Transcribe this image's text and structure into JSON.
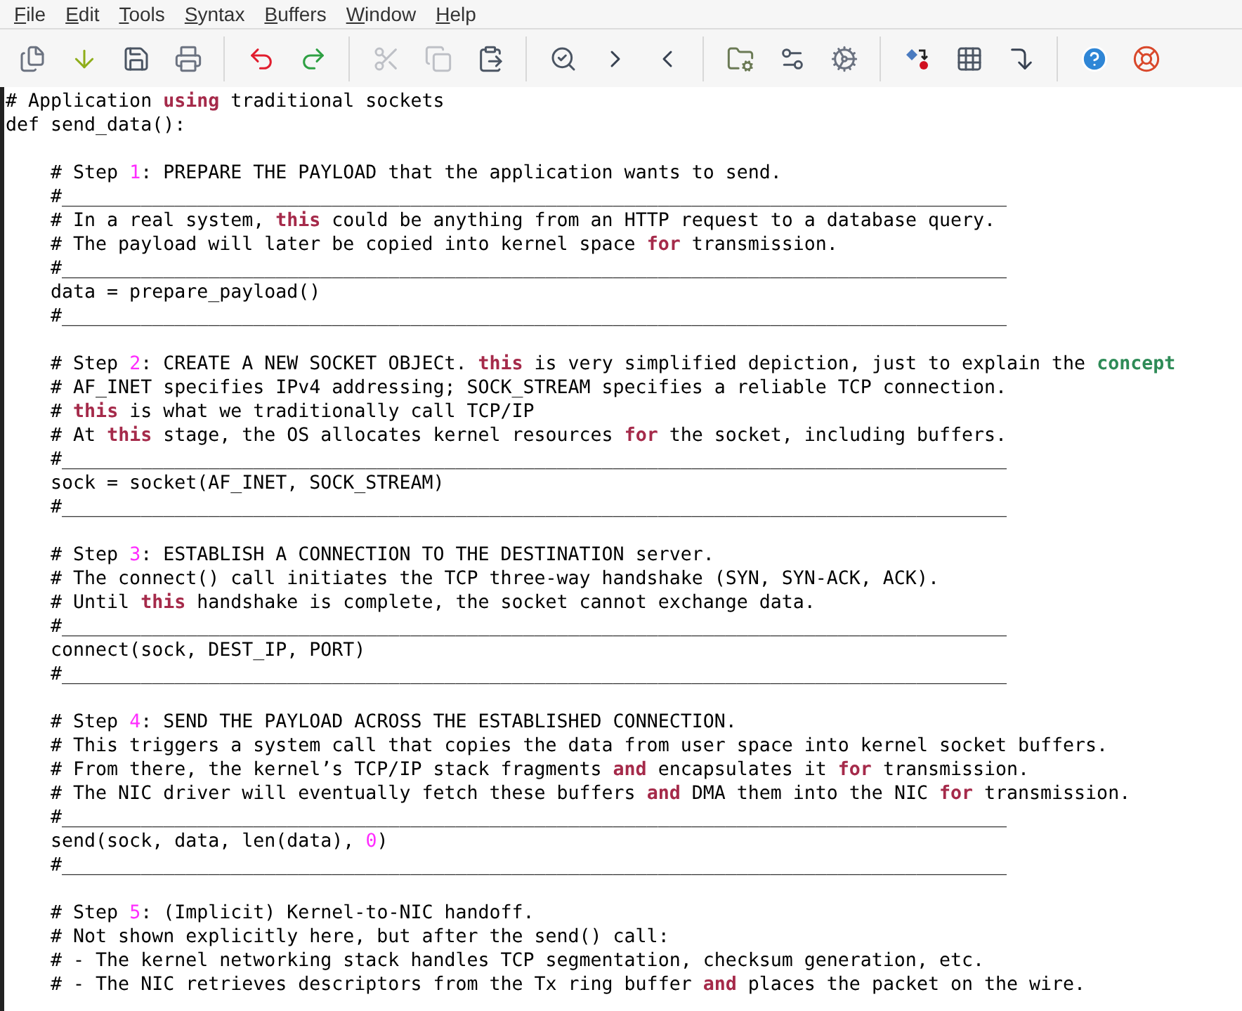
{
  "menu": [
    {
      "label": "File"
    },
    {
      "label": "Edit"
    },
    {
      "label": "Tools"
    },
    {
      "label": "Syntax"
    },
    {
      "label": "Buffers"
    },
    {
      "label": "Window"
    },
    {
      "label": "Help"
    }
  ],
  "toolbar_groups": [
    {
      "buttons": [
        {
          "kind": "open",
          "disabled": false
        },
        {
          "kind": "load",
          "disabled": false
        },
        {
          "kind": "save",
          "disabled": false
        },
        {
          "kind": "print",
          "disabled": false
        }
      ]
    },
    {
      "buttons": [
        {
          "kind": "undo",
          "disabled": false
        },
        {
          "kind": "redo",
          "disabled": false
        }
      ]
    },
    {
      "buttons": [
        {
          "kind": "cut",
          "disabled": true
        },
        {
          "kind": "copy",
          "disabled": true
        },
        {
          "kind": "paste",
          "disabled": false
        }
      ]
    },
    {
      "buttons": [
        {
          "kind": "find",
          "disabled": false
        },
        {
          "kind": "next",
          "disabled": false
        },
        {
          "kind": "prev",
          "disabled": false
        }
      ]
    },
    {
      "buttons": [
        {
          "kind": "load_session",
          "disabled": false
        },
        {
          "kind": "save_session",
          "disabled": false
        },
        {
          "kind": "run_script",
          "disabled": false
        }
      ]
    },
    {
      "buttons": [
        {
          "kind": "make",
          "disabled": false
        },
        {
          "kind": "tags",
          "disabled": false
        },
        {
          "kind": "jump",
          "disabled": false
        }
      ]
    },
    {
      "buttons": [
        {
          "kind": "help",
          "disabled": false
        },
        {
          "kind": "find_help",
          "disabled": false
        }
      ]
    }
  ],
  "editor_lines": [
    {
      "kind": "code",
      "segments": [
        {
          "text": "# Application ",
          "kind": "plain"
        },
        {
          "text": "using",
          "kind": "keyword"
        },
        {
          "text": " traditional sockets",
          "kind": "plain"
        }
      ]
    },
    {
      "kind": "code",
      "segments": [
        {
          "text": "def send_data():",
          "kind": "plain"
        }
      ]
    },
    {
      "kind": "blank"
    },
    {
      "kind": "code",
      "segments": [
        {
          "text": "    # Step ",
          "kind": "plain"
        },
        {
          "text": "1",
          "kind": "number"
        },
        {
          "text": ": PREPARE THE PAYLOAD that the application wants to send.",
          "kind": "plain"
        }
      ]
    },
    {
      "kind": "code",
      "segments": [
        {
          "text": "    #____________________________________________________________________________________",
          "kind": "plain"
        }
      ]
    },
    {
      "kind": "code",
      "segments": [
        {
          "text": "    # In a real system, ",
          "kind": "plain"
        },
        {
          "text": "this",
          "kind": "keyword"
        },
        {
          "text": " could be anything from an HTTP request to a database query.",
          "kind": "plain"
        }
      ]
    },
    {
      "kind": "code",
      "segments": [
        {
          "text": "    # The payload will later be copied into kernel space ",
          "kind": "plain"
        },
        {
          "text": "for",
          "kind": "keyword"
        },
        {
          "text": " transmission.",
          "kind": "plain"
        }
      ]
    },
    {
      "kind": "code",
      "segments": [
        {
          "text": "    #____________________________________________________________________________________",
          "kind": "plain"
        }
      ]
    },
    {
      "kind": "code",
      "segments": [
        {
          "text": "    data = prepare_payload()",
          "kind": "plain"
        }
      ]
    },
    {
      "kind": "code",
      "segments": [
        {
          "text": "    #____________________________________________________________________________________",
          "kind": "plain"
        }
      ]
    },
    {
      "kind": "blank"
    },
    {
      "kind": "code",
      "segments": [
        {
          "text": "    # Step ",
          "kind": "plain"
        },
        {
          "text": "2",
          "kind": "number"
        },
        {
          "text": ": CREATE A NEW SOCKET OBJECt. ",
          "kind": "plain"
        },
        {
          "text": "this",
          "kind": "keyword"
        },
        {
          "text": " is very simplified depiction, just to explain the ",
          "kind": "plain"
        },
        {
          "text": "concept",
          "kind": "special"
        }
      ]
    },
    {
      "kind": "code",
      "segments": [
        {
          "text": "    # AF_INET specifies IPv4 addressing; SOCK_STREAM specifies a reliable TCP connection.",
          "kind": "plain"
        }
      ]
    },
    {
      "kind": "code",
      "segments": [
        {
          "text": "    # ",
          "kind": "plain"
        },
        {
          "text": "this",
          "kind": "keyword"
        },
        {
          "text": " is what we traditionally call TCP/IP",
          "kind": "plain"
        }
      ]
    },
    {
      "kind": "code",
      "segments": [
        {
          "text": "    # At ",
          "kind": "plain"
        },
        {
          "text": "this",
          "kind": "keyword"
        },
        {
          "text": " stage, the OS allocates kernel resources ",
          "kind": "plain"
        },
        {
          "text": "for",
          "kind": "keyword"
        },
        {
          "text": " the socket, including buffers.",
          "kind": "plain"
        }
      ]
    },
    {
      "kind": "code",
      "segments": [
        {
          "text": "    #____________________________________________________________________________________",
          "kind": "plain"
        }
      ]
    },
    {
      "kind": "code",
      "segments": [
        {
          "text": "    sock = socket(AF_INET, SOCK_STREAM)",
          "kind": "plain"
        }
      ]
    },
    {
      "kind": "code",
      "segments": [
        {
          "text": "    #____________________________________________________________________________________",
          "kind": "plain"
        }
      ]
    },
    {
      "kind": "blank"
    },
    {
      "kind": "code",
      "segments": [
        {
          "text": "    # Step ",
          "kind": "plain"
        },
        {
          "text": "3",
          "kind": "number"
        },
        {
          "text": ": ESTABLISH A CONNECTION TO THE DESTINATION server.",
          "kind": "plain"
        }
      ]
    },
    {
      "kind": "code",
      "segments": [
        {
          "text": "    # The connect() call initiates the TCP three-way handshake (SYN, SYN-ACK, ACK).",
          "kind": "plain"
        }
      ]
    },
    {
      "kind": "code",
      "segments": [
        {
          "text": "    # Until ",
          "kind": "plain"
        },
        {
          "text": "this",
          "kind": "keyword"
        },
        {
          "text": " handshake is complete, the socket cannot exchange data.",
          "kind": "plain"
        }
      ]
    },
    {
      "kind": "code",
      "segments": [
        {
          "text": "    #____________________________________________________________________________________",
          "kind": "plain"
        }
      ]
    },
    {
      "kind": "code",
      "segments": [
        {
          "text": "    connect(sock, DEST_IP, PORT)",
          "kind": "plain"
        }
      ]
    },
    {
      "kind": "code",
      "segments": [
        {
          "text": "    #____________________________________________________________________________________",
          "kind": "plain"
        }
      ]
    },
    {
      "kind": "blank"
    },
    {
      "kind": "code",
      "segments": [
        {
          "text": "    # Step ",
          "kind": "plain"
        },
        {
          "text": "4",
          "kind": "number"
        },
        {
          "text": ": SEND THE PAYLOAD ACROSS THE ESTABLISHED CONNECTION.",
          "kind": "plain"
        }
      ]
    },
    {
      "kind": "code",
      "segments": [
        {
          "text": "    # This triggers a system call that copies the data from user space into kernel socket buffers.",
          "kind": "plain"
        }
      ]
    },
    {
      "kind": "code",
      "segments": [
        {
          "text": "    # From there, the kernel’s TCP/IP stack fragments ",
          "kind": "plain"
        },
        {
          "text": "and",
          "kind": "keyword"
        },
        {
          "text": " encapsulates it ",
          "kind": "plain"
        },
        {
          "text": "for",
          "kind": "keyword"
        },
        {
          "text": " transmission.",
          "kind": "plain"
        }
      ]
    },
    {
      "kind": "code",
      "segments": [
        {
          "text": "    # The NIC driver will eventually fetch these buffers ",
          "kind": "plain"
        },
        {
          "text": "and",
          "kind": "keyword"
        },
        {
          "text": " DMA them into the NIC ",
          "kind": "plain"
        },
        {
          "text": "for",
          "kind": "keyword"
        },
        {
          "text": " transmission.",
          "kind": "plain"
        }
      ]
    },
    {
      "kind": "code",
      "segments": [
        {
          "text": "    #____________________________________________________________________________________",
          "kind": "plain"
        }
      ]
    },
    {
      "kind": "code",
      "segments": [
        {
          "text": "    send(sock, data, len(data), ",
          "kind": "plain"
        },
        {
          "text": "0",
          "kind": "number"
        },
        {
          "text": ")",
          "kind": "plain"
        }
      ]
    },
    {
      "kind": "code",
      "segments": [
        {
          "text": "    #____________________________________________________________________________________",
          "kind": "plain"
        }
      ]
    },
    {
      "kind": "blank"
    },
    {
      "kind": "code",
      "segments": [
        {
          "text": "    # Step ",
          "kind": "plain"
        },
        {
          "text": "5",
          "kind": "number"
        },
        {
          "text": ": (Implicit) Kernel-to-NIC handoff.",
          "kind": "plain"
        }
      ]
    },
    {
      "kind": "code",
      "segments": [
        {
          "text": "    # Not shown explicitly here, but after the send() call:",
          "kind": "plain"
        }
      ]
    },
    {
      "kind": "code",
      "segments": [
        {
          "text": "    # - The kernel networking stack handles TCP segmentation, checksum generation, etc.",
          "kind": "plain"
        }
      ]
    },
    {
      "kind": "code",
      "segments": [
        {
          "text": "    # - The NIC retrieves descriptors from the Tx ring buffer ",
          "kind": "plain"
        },
        {
          "text": "and",
          "kind": "keyword"
        },
        {
          "text": " places the packet on the wire.",
          "kind": "plain"
        }
      ]
    }
  ]
}
